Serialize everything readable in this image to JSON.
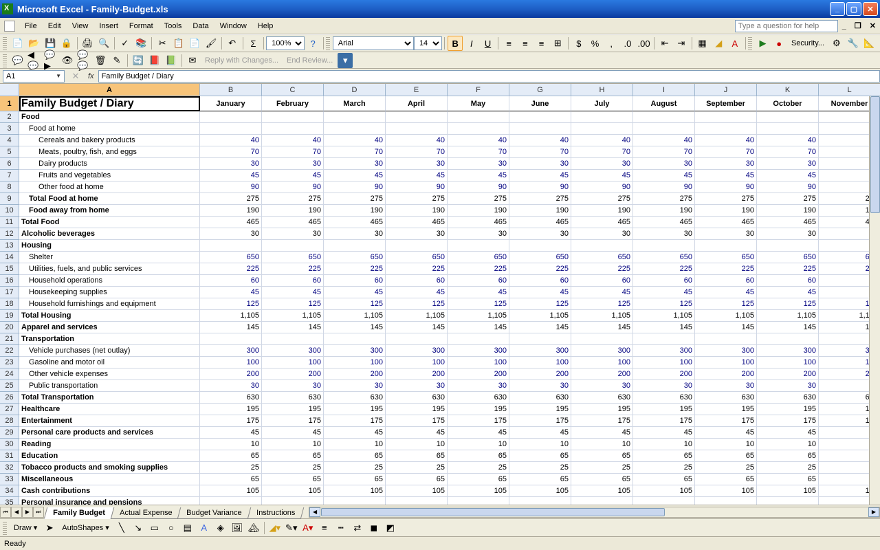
{
  "title": "Microsoft Excel - Family-Budget.xls",
  "menus": [
    "File",
    "Edit",
    "View",
    "Insert",
    "Format",
    "Tools",
    "Data",
    "Window",
    "Help"
  ],
  "help_placeholder": "Type a question for help",
  "toolbar1": {
    "zoom": "100%",
    "font": "Arial",
    "fontsize": "14",
    "security": "Security..."
  },
  "review": {
    "reply": "Reply with Changes...",
    "end": "End Review..."
  },
  "namebox": "A1",
  "formula": "Family Budget / Diary",
  "columns": [
    "A",
    "B",
    "C",
    "D",
    "E",
    "F",
    "G",
    "H",
    "I",
    "J",
    "K",
    "L"
  ],
  "months": [
    "January",
    "February",
    "March",
    "April",
    "May",
    "June",
    "July",
    "August",
    "September",
    "October",
    "November"
  ],
  "rows": [
    {
      "n": 1,
      "label": "Family Budget / Diary",
      "type": "title"
    },
    {
      "n": 2,
      "label": "Food",
      "type": "section"
    },
    {
      "n": 3,
      "label": "Food at home",
      "type": "sub1"
    },
    {
      "n": 4,
      "label": "Cereals and bakery products",
      "type": "sub2",
      "val": 40
    },
    {
      "n": 5,
      "label": "Meats, poultry, fish, and eggs",
      "type": "sub2",
      "val": 70
    },
    {
      "n": 6,
      "label": "Dairy products",
      "type": "sub2",
      "val": 30
    },
    {
      "n": 7,
      "label": "Fruits and vegetables",
      "type": "sub2",
      "val": 45
    },
    {
      "n": 8,
      "label": "Other food at home",
      "type": "sub2",
      "val": 90
    },
    {
      "n": 9,
      "label": "Total Food at home",
      "type": "bold1",
      "val": 275
    },
    {
      "n": 10,
      "label": "Food away from home",
      "type": "bold1",
      "val": 190
    },
    {
      "n": 11,
      "label": "Total Food",
      "type": "bold",
      "val": 465
    },
    {
      "n": 12,
      "label": "Alcoholic beverages",
      "type": "bold",
      "val": 30
    },
    {
      "n": 13,
      "label": "Housing",
      "type": "section"
    },
    {
      "n": 14,
      "label": "Shelter",
      "type": "sub1",
      "val": 650
    },
    {
      "n": 15,
      "label": "Utilities, fuels, and public services",
      "type": "sub1",
      "val": 225
    },
    {
      "n": 16,
      "label": "Household operations",
      "type": "sub1",
      "val": 60
    },
    {
      "n": 17,
      "label": "Housekeeping supplies",
      "type": "sub1",
      "val": 45
    },
    {
      "n": 18,
      "label": "Household furnishings and equipment",
      "type": "sub1",
      "val": 125
    },
    {
      "n": 19,
      "label": "Total Housing",
      "type": "bold",
      "val": "1,105"
    },
    {
      "n": 20,
      "label": "Apparel and services",
      "type": "bold",
      "val": 145
    },
    {
      "n": 21,
      "label": "Transportation",
      "type": "section"
    },
    {
      "n": 22,
      "label": "Vehicle purchases (net outlay)",
      "type": "sub1",
      "val": 300
    },
    {
      "n": 23,
      "label": "Gasoline and motor oil",
      "type": "sub1",
      "val": 100
    },
    {
      "n": 24,
      "label": "Other vehicle expenses",
      "type": "sub1",
      "val": 200
    },
    {
      "n": 25,
      "label": "Public transportation",
      "type": "sub1",
      "val": 30
    },
    {
      "n": 26,
      "label": "Total Transportation",
      "type": "bold",
      "val": 630
    },
    {
      "n": 27,
      "label": "Healthcare",
      "type": "bold",
      "val": 195
    },
    {
      "n": 28,
      "label": "Entertainment",
      "type": "bold",
      "val": 175
    },
    {
      "n": 29,
      "label": "Personal care products and services",
      "type": "bold",
      "val": 45
    },
    {
      "n": 30,
      "label": "Reading",
      "type": "bold",
      "val": 10
    },
    {
      "n": 31,
      "label": "Education",
      "type": "bold",
      "val": 65
    },
    {
      "n": 32,
      "label": "Tobacco products and smoking supplies",
      "type": "bold",
      "val": 25
    },
    {
      "n": 33,
      "label": "Miscellaneous",
      "type": "bold",
      "val": 65
    },
    {
      "n": 34,
      "label": "Cash contributions",
      "type": "bold",
      "val": 105
    },
    {
      "n": 35,
      "label": "Personal insurance and pensions",
      "type": "section"
    }
  ],
  "tabs": [
    "Family Budget",
    "Actual Expense",
    "Budget Variance",
    "Instructions"
  ],
  "active_tab": 0,
  "draw_label": "Draw",
  "autoshapes": "AutoShapes",
  "status": "Ready"
}
